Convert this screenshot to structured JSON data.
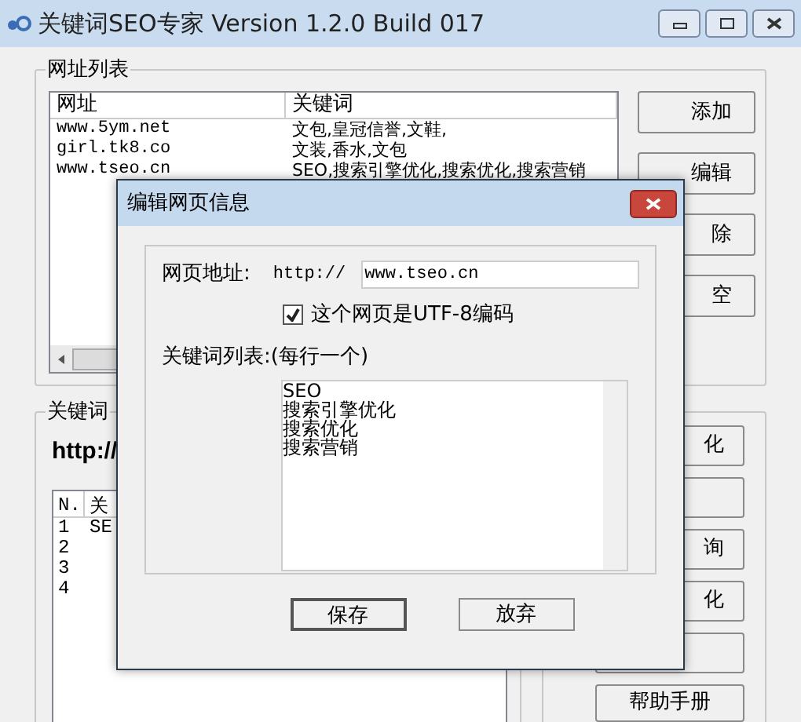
{
  "window": {
    "title": "关键词SEO专家 Version 1.2.0 Build 017"
  },
  "url_group": {
    "title": "网址列表",
    "columns": [
      "网址",
      "关键词"
    ],
    "rows": [
      {
        "url": "www.5ym.net",
        "keywords": "文包,皇冠信誉,文鞋,"
      },
      {
        "url": "girl.tk8.co",
        "keywords": "文装,香水,文包"
      },
      {
        "url": "www.tseo.cn",
        "keywords": "SEO,搜索引擎优化,搜索优化,搜索营销"
      }
    ],
    "buttons": [
      "添加",
      "编辑",
      "除",
      "空"
    ]
  },
  "keyword_group": {
    "title": "关键词",
    "url": "http://",
    "columns": [
      "N.",
      "关"
    ],
    "rows": [
      {
        "n": "1",
        "text": "SE"
      },
      {
        "n": "2"
      },
      {
        "n": "3"
      },
      {
        "n": "4"
      }
    ],
    "buttons": [
      {
        "kind": "labeled",
        "label": "化"
      },
      {
        "kind": "blank"
      },
      {
        "kind": "labeled",
        "label": "询"
      },
      {
        "kind": "labeled",
        "label": "化"
      },
      {
        "kind": "blank"
      }
    ],
    "help_button": "帮助手册"
  },
  "dialog": {
    "title": "编辑网页信息",
    "address_label": "网页地址:",
    "prefix": "http://",
    "address": "www.tseo.cn",
    "utf8": {
      "label": "这个网页是UTF-8编码",
      "checked": true
    },
    "keywords_label": "关键词列表:(每行一个)",
    "keywords": [
      "SEO",
      "搜索引擎优化",
      "搜索优化",
      "搜索营销"
    ],
    "buttons": [
      {
        "label": "保存",
        "default": true
      },
      {
        "label": "放弃",
        "default": false
      }
    ]
  }
}
